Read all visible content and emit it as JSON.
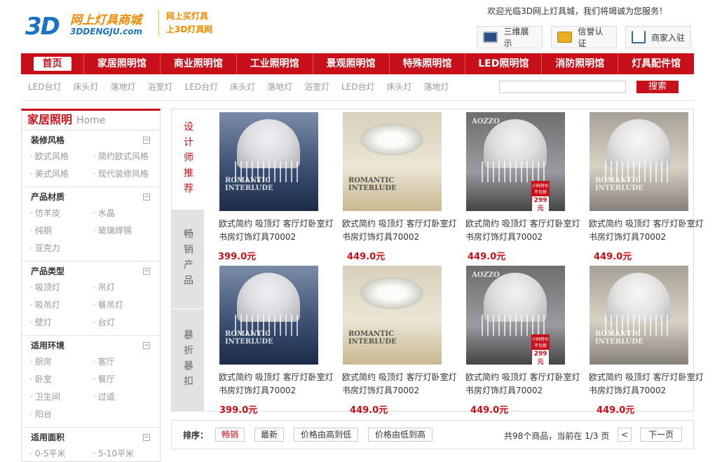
{
  "header": {
    "logo_3d": "3D",
    "logo_cn": "网上灯具商城",
    "logo_en": "3DDENGJU.com",
    "slogan_1": "网上买灯具",
    "slogan_2": "上3D灯具网",
    "welcome": "欢迎光临3D网上灯具城，我们将竭诚为您服务！",
    "buttons": [
      {
        "label": "三维展示",
        "icon": "monitor-icon"
      },
      {
        "label": "信誉认证",
        "icon": "credit-card-icon"
      },
      {
        "label": "商家入驻",
        "icon": "house-icon"
      }
    ]
  },
  "nav": {
    "items": [
      "首页",
      "家居照明馆",
      "商业照明馆",
      "工业照明馆",
      "景观照明馆",
      "特殊照明馆",
      "LED照明馆",
      "消防照明馆",
      "灯具配件馆"
    ]
  },
  "subnav": {
    "links": [
      "LED台灯",
      "床头灯",
      "落地灯",
      "浴室灯",
      "LED台灯",
      "床头灯",
      "落地灯",
      "浴室灯",
      "LED台灯",
      "床头灯",
      "落地灯"
    ],
    "search_value": "",
    "search_button": "搜索"
  },
  "sidebar": {
    "title": "家居照明",
    "title_en": "Home",
    "toggle_symbol": "−",
    "sections": [
      {
        "title": "装修风格",
        "links": [
          "欧式风格",
          "简约欧式风格",
          "美式风格",
          "现代装修风格"
        ]
      },
      {
        "title": "产品材质",
        "links": [
          "仿羊皮",
          "水晶",
          "纯铜",
          "玻璃焊锡",
          "亚克力"
        ]
      },
      {
        "title": "产品类型",
        "links": [
          "吸顶灯",
          "吊灯",
          "吸吊灯",
          "餐吊灯",
          "壁灯",
          "台灯"
        ]
      },
      {
        "title": "适用环境",
        "links": [
          "厨房",
          "客厅",
          "卧室",
          "餐厅",
          "卫生间",
          "过道",
          "阳台"
        ]
      },
      {
        "title": "适用面积",
        "links": [
          "0-5平米",
          "5-10平米"
        ]
      }
    ]
  },
  "tabs": [
    "设计师推荐",
    "畅销产品",
    "暴折暴扣"
  ],
  "products": [
    {
      "name": "欧式简约 吸顶灯 客厅灯卧室灯书房灯饰灯具70002",
      "price": "399.0元"
    },
    {
      "name": "欧式简约 吸顶灯 客厅灯卧室灯书房灯饰灯具70002",
      "price": "449.0元"
    },
    {
      "name": "欧式简约 吸顶灯 客厅灯卧室灯书房灯饰灯具70002",
      "price": "449.0元"
    },
    {
      "name": "欧式简约 吸顶灯 客厅灯卧室灯书房灯饰灯具70002",
      "price": "449.0元"
    },
    {
      "name": "欧式简约 吸顶灯 客厅灯卧室灯书房灯饰灯具70002",
      "price": "399.0元"
    },
    {
      "name": "欧式简约 吸顶灯 客厅灯卧室灯书房灯饰灯具70002",
      "price": "449.0元"
    },
    {
      "name": "欧式简约 吸顶灯 客厅灯卧室灯书房灯饰灯具70002",
      "price": "449.0元"
    },
    {
      "name": "欧式简约 吸顶灯 客厅灯卧室灯书房灯饰灯具70002",
      "price": "449.0元"
    }
  ],
  "product_image_text": {
    "romantic": "ROMANTIC INTERLUDE",
    "brand": "AOZZO",
    "promo_line": "小码特价 不包邮",
    "promo_price": "299元"
  },
  "pager": {
    "sort_label": "排序：",
    "sort_options": [
      "畅销",
      "最新",
      "价格由高到低",
      "价格由低到高"
    ],
    "info": "共98个商品，当前在 1/3 页",
    "prev": "<",
    "next": "下一页"
  },
  "colors": {
    "accent": "#c8101a",
    "logo_blue": "#1a74c4",
    "logo_orange": "#f08a00"
  }
}
